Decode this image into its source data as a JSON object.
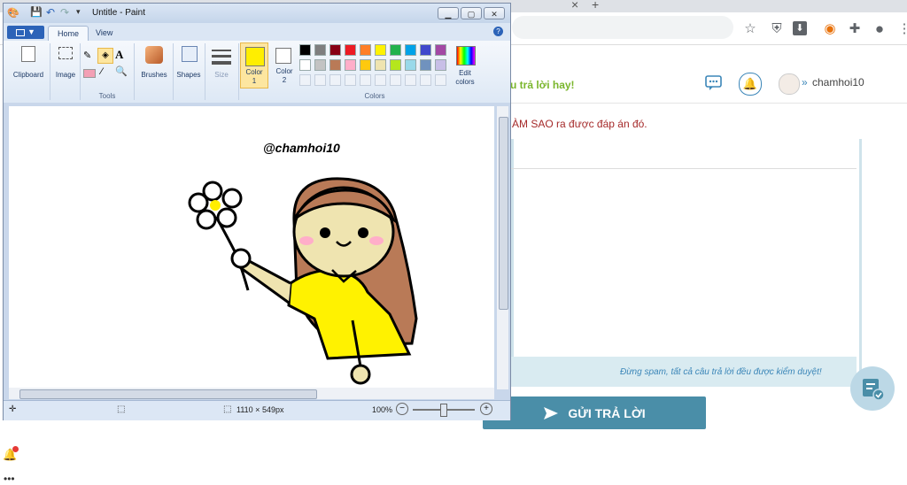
{
  "browser": {
    "toolbar_icons": [
      "star-icon",
      "shield-icon",
      "download-icon",
      "extension-icon",
      "puzzle-icon",
      "account-icon",
      "menu-icon"
    ]
  },
  "site": {
    "header_title": "u trả lời hay!",
    "username": "chamhoi10",
    "question_fragment": "ÀM SAO ra được đáp án đó.",
    "footer_note": "Đừng spam, tất cả câu trả lời đều được kiểm duyệt!",
    "send_label": "GỬI TRẢ LỜI"
  },
  "paint": {
    "title": "Untitle - Paint",
    "file_menu": "▼",
    "tabs": [
      "Home",
      "View"
    ],
    "groups": {
      "clipboard": "Clipboard",
      "image": "Image",
      "tools": "Tools",
      "brushes": "Brushes",
      "shapes": "Shapes",
      "size": "Size",
      "color1": "Color\n1",
      "color2": "Color\n2",
      "colors": "Colors",
      "edit_colors": "Edit\ncolors"
    },
    "color1_value": "#ffee00",
    "palette": [
      "#000000",
      "#7f7f7f",
      "#880015",
      "#ed1c24",
      "#ff7f27",
      "#fff200",
      "#22b14c",
      "#00a2e8",
      "#3f48cc",
      "#a349a4",
      "#ffffff",
      "#c3c3c3",
      "#b97a57",
      "#ffaec9",
      "#ffc90e",
      "#efe4b0",
      "#b5e61d",
      "#99d9ea",
      "#7092be",
      "#c8bfe7"
    ],
    "canvas_watermark": "@chamhoi10",
    "status": {
      "dimensions": "1110 × 549px",
      "zoom": "100%"
    }
  }
}
